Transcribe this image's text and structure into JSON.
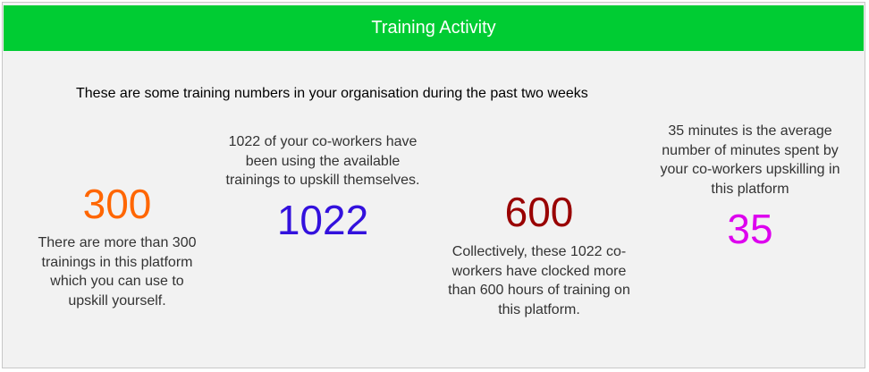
{
  "header": {
    "title": "Training Activity",
    "color": "#00cc33"
  },
  "intro": "These are some training numbers in your organisation during the past two weeks",
  "stats": [
    {
      "value": "300",
      "description": "There are more than 300 trainings in this platform which you can use to upskill yourself.",
      "color": "#ff6600"
    },
    {
      "value": "1022",
      "description": "1022 of your co-workers have been using the available trainings to upskill themselves.",
      "color": "#3311dd"
    },
    {
      "value": "600",
      "description": "Collectively, these 1022 co-workers have clocked more than 600 hours of training on this platform.",
      "color": "#990000"
    },
    {
      "value": "35",
      "description": "35 minutes is the average number of minutes spent by your co-workers upskilling in this platform",
      "color": "#dd00ee"
    }
  ]
}
